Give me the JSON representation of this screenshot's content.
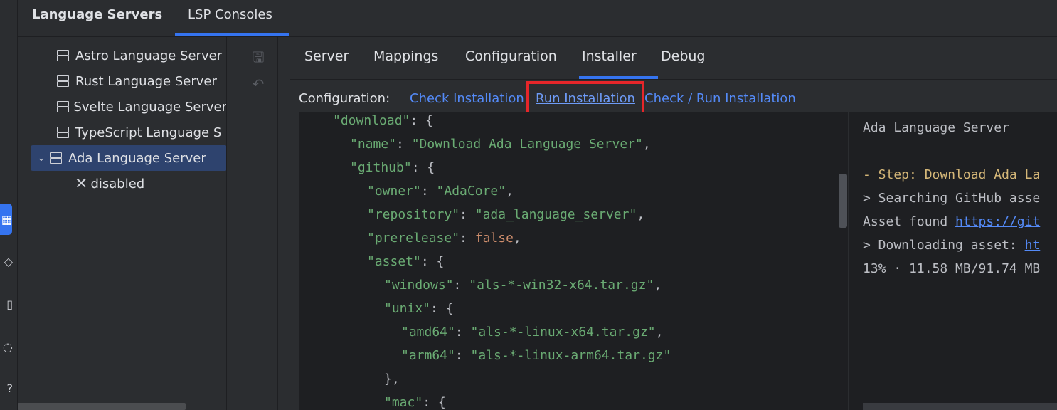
{
  "header": {
    "tabs": [
      {
        "label": "Language Servers",
        "active": false
      },
      {
        "label": "LSP Consoles",
        "active": true
      }
    ]
  },
  "tree": {
    "items": [
      {
        "label": "Astro Language Server"
      },
      {
        "label": "Rust Language Server"
      },
      {
        "label": "Svelte Language Server"
      },
      {
        "label": "TypeScript Language S"
      },
      {
        "label": "Ada Language Server",
        "selected": true,
        "expanded": true
      },
      {
        "label": "disabled"
      }
    ]
  },
  "actions": {
    "save_icon": "save-icon",
    "undo_icon": "undo-icon"
  },
  "subtabs": {
    "items": [
      "Server",
      "Mappings",
      "Configuration",
      "Installer",
      "Debug"
    ],
    "active": "Installer"
  },
  "config": {
    "label": "Configuration:",
    "check_installation": "Check Installation",
    "run_installation": "Run Installation",
    "check_run_installation": "Check / Run Installation"
  },
  "editor": {
    "lines": [
      {
        "key": "\"download\"",
        "rest": ": {"
      },
      {
        "key": "\"name\"",
        "rest": ": ",
        "value": "\"Download Ada Language Server\"",
        "tail": ","
      },
      {
        "key": "\"github\"",
        "rest": ": {"
      },
      {
        "key": "\"owner\"",
        "rest": ": ",
        "value": "\"AdaCore\"",
        "tail": ","
      },
      {
        "key": "\"repository\"",
        "rest": ": ",
        "value": "\"ada_language_server\"",
        "tail": ","
      },
      {
        "key": "\"prerelease\"",
        "rest": ": ",
        "kw": "false",
        "tail": ","
      },
      {
        "key": "\"asset\"",
        "rest": ": {"
      },
      {
        "key": "\"windows\"",
        "rest": ": ",
        "value": "\"als-*-win32-x64.tar.gz\"",
        "tail": ","
      },
      {
        "key": "\"unix\"",
        "rest": ": {"
      },
      {
        "key": "\"amd64\"",
        "rest": ": ",
        "value": "\"als-*-linux-x64.tar.gz\"",
        "tail": ","
      },
      {
        "key": "\"arm64\"",
        "rest": ": ",
        "value": "\"als-*-linux-arm64.tar.gz\""
      },
      {
        "punct": "},"
      },
      {
        "key": "\"mac\"",
        "rest": ": {"
      }
    ]
  },
  "console": {
    "lines": [
      {
        "text": "Ada Language Server",
        "style": "normal"
      },
      {
        "text": "",
        "style": "normal"
      },
      {
        "text": "- Step: Download Ada La",
        "style": "step"
      },
      {
        "text": "> Searching GitHub asse",
        "style": "normal"
      },
      {
        "text": "Asset found ",
        "link": "https://git",
        "style": "normal"
      },
      {
        "text": "> Downloading asset: ",
        "link": "ht",
        "style": "normal"
      },
      {
        "text": "13% · 11.58 MB/91.74 MB",
        "style": "normal"
      }
    ]
  },
  "colors": {
    "accent": "#3574f0",
    "highlight": "#e5262a",
    "json_string": "#6aab73",
    "json_keyword": "#cf8e6d",
    "console_step": "#d5b778",
    "link": "#548af7"
  }
}
